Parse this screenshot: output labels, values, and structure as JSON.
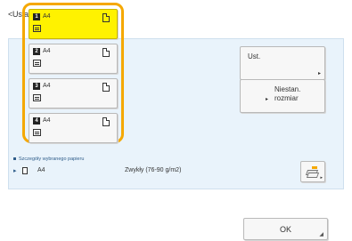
{
  "title": "<Ustawienia Papieru>",
  "drawers": [
    {
      "number": "1",
      "size": "A4",
      "selected": true
    },
    {
      "number": "2",
      "size": "A4",
      "selected": false
    },
    {
      "number": "3",
      "size": "A4",
      "selected": false
    },
    {
      "number": "4",
      "size": "A4",
      "selected": false
    }
  ],
  "buttons": {
    "settings_label": "Ust.",
    "custom_size_label_line1": "Niestan.",
    "custom_size_label_line2": "rozmiar",
    "ok_label": "OK"
  },
  "current": {
    "label": "Szczegóły wybranego papieru",
    "paper_size": "A4",
    "paper_type": "Zwykły (76-90 g/m2)"
  },
  "colors": {
    "selected_drawer": "#fff200",
    "highlight_ring": "#f5a800",
    "panel_background": "#e9f3fb",
    "accent_text": "#2f5d8a"
  },
  "icons": {
    "drawer_badge": "drawer-number-icon",
    "drawer_tray": "paper-tray-icon",
    "drawer_sheet": "paper-sheet-icon",
    "paper_feed": "paper-stack-icon",
    "expand": "arrow-icon"
  }
}
